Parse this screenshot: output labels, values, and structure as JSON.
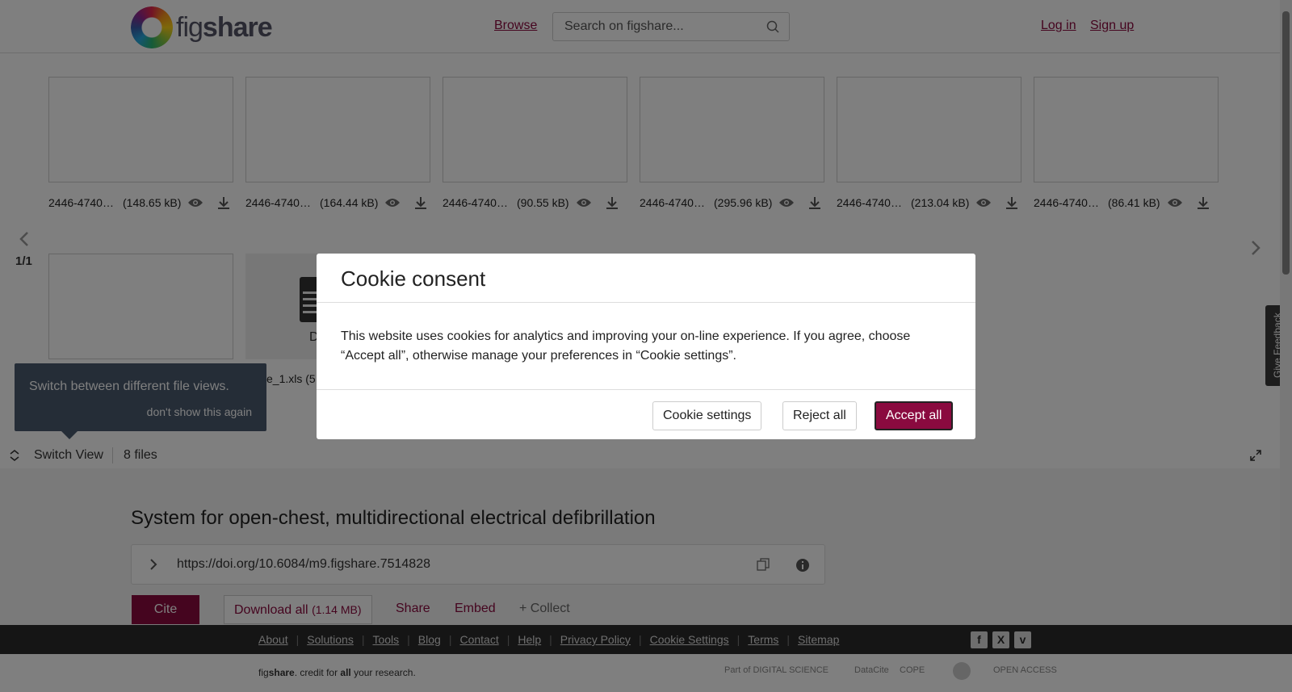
{
  "header": {
    "logo_fig": "fig",
    "logo_share": "share",
    "browse": "Browse",
    "search_placeholder": "Search on figshare...",
    "login": "Log in",
    "signup": "Sign up"
  },
  "files": [
    {
      "name": "2446-4740-...",
      "size": "(148.65 kB)"
    },
    {
      "name": "2446-4740-...",
      "size": "(164.44 kB)"
    },
    {
      "name": "2446-4740-...",
      "size": "(90.55 kB)"
    },
    {
      "name": "2446-4740-...",
      "size": "(295.96 kB)"
    },
    {
      "name": "2446-4740-...",
      "size": "(213.04 kB)"
    },
    {
      "name": "2446-4740-...",
      "size": "(86.41 kB)"
    }
  ],
  "pager": "1/1",
  "tooltip": {
    "text": "Switch between different file views.",
    "dismiss": "don't show this again"
  },
  "partial_file": {
    "name": "e_1.xls (5",
    "doc_label": "D"
  },
  "viewbar": {
    "switch_view": "Switch View",
    "file_count": "8 files"
  },
  "item": {
    "title": "System for open-chest, multidirectional electrical defibrillation",
    "doi": "https://doi.org/10.6084/m9.figshare.7514828"
  },
  "actions": {
    "cite": "Cite",
    "download_all": "Download all",
    "download_size": "(1.14 MB)",
    "share": "Share",
    "embed": "Embed",
    "collect": "+ Collect"
  },
  "footer": {
    "links": [
      "About",
      "Solutions",
      "Tools",
      "Blog",
      "Contact",
      "Help",
      "Privacy Policy",
      "Cookie Settings",
      "Terms",
      "Sitemap"
    ],
    "tagline_fig": "fig",
    "tagline_share": "share",
    "tagline_rest1": ". credit for ",
    "tagline_all": "all",
    "tagline_rest2": " your research.",
    "partners": [
      "Part of DIGITAL SCIENCE",
      "DataCite",
      "COPE",
      "",
      "OPEN ACCESS"
    ]
  },
  "modal": {
    "title": "Cookie consent",
    "body": "This website uses cookies for analytics and improving your on-line experience. If you agree, choose “Accept all”, otherwise manage your preferences in “Cookie settings”.",
    "settings": "Cookie settings",
    "reject": "Reject all",
    "accept": "Accept all"
  },
  "feedback": "Give Feedback",
  "colors": {
    "brand": "#8a0a3f",
    "tooltip": "#4a5a6e",
    "footer": "#2b2b2b"
  }
}
